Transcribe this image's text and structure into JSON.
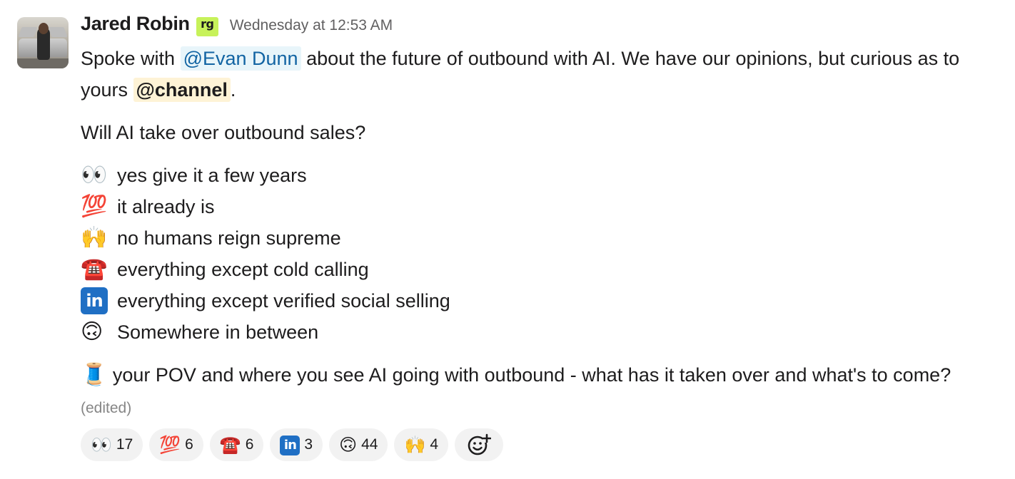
{
  "message": {
    "author": "Jared Robin",
    "org_badge": "rg",
    "timestamp": "Wednesday at 12:53 AM",
    "intro": {
      "before_mention": "Spoke with ",
      "user_mention": "@Evan Dunn",
      "after_mention": " about the future of outbound with AI. We have our opinions, but curious as to yours ",
      "channel_mention": "@channel",
      "end": "."
    },
    "question": "Will AI take over outbound sales?",
    "options": [
      {
        "emoji": "👀",
        "icon": "eyes-icon",
        "text": "yes give it a few years"
      },
      {
        "emoji": "💯",
        "icon": "hundred-points-icon",
        "text": "it already is"
      },
      {
        "emoji": "🙌",
        "icon": "raised-hands-icon",
        "text": "no humans reign supreme"
      },
      {
        "emoji": "☎️",
        "icon": "telephone-icon",
        "text": "everything except cold calling"
      },
      {
        "emoji": "in",
        "icon": "linkedin-icon",
        "text": "everything except verified social selling"
      },
      {
        "emoji": "🙃",
        "icon": "upside-down-face-icon",
        "text": "Somewhere in between"
      }
    ],
    "thread_prompt": {
      "emoji": "🧵",
      "text": " your POV and where you see AI going with outbound - what has it taken over and what's to come? ",
      "edited": "(edited)"
    }
  },
  "reactions": [
    {
      "emoji": "👀",
      "icon": "eyes-icon",
      "count": "17"
    },
    {
      "emoji": "💯",
      "icon": "hundred-points-icon",
      "count": "6"
    },
    {
      "emoji": "☎️",
      "icon": "telephone-icon",
      "count": "6"
    },
    {
      "emoji": "in",
      "icon": "linkedin-icon",
      "count": "3"
    },
    {
      "emoji": "🙃",
      "icon": "upside-down-face-icon",
      "count": "44"
    },
    {
      "emoji": "🙌",
      "icon": "raised-hands-icon",
      "count": "4"
    }
  ],
  "colors": {
    "mention_user_bg": "#e8f5fa",
    "mention_user_text": "#1264a3",
    "mention_channel_bg": "#fef3d6",
    "org_badge_bg": "#c7f25a",
    "reaction_bg": "#f2f2f2",
    "linkedin_blue": "#1f6fc4"
  }
}
